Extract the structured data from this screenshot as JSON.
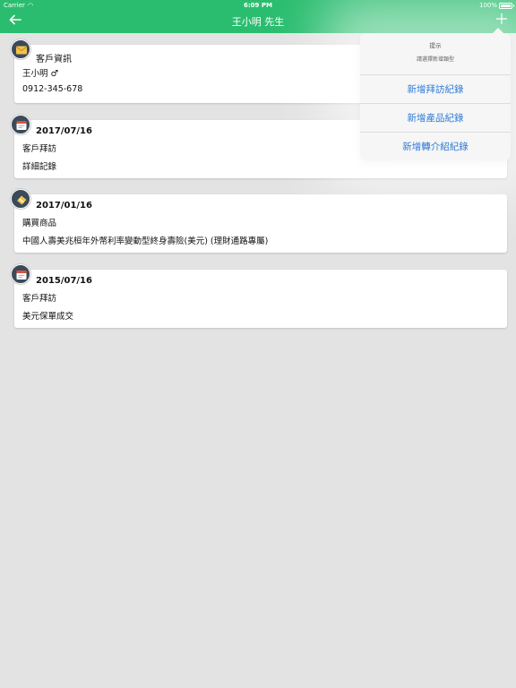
{
  "status_bar": {
    "carrier": "Carrier",
    "time": "6:09 PM",
    "battery": "100%",
    "battery_level": 1.0
  },
  "nav": {
    "title": "王小明 先生",
    "back_icon": "arrow-left-icon",
    "add_icon": "plus-icon"
  },
  "colors": {
    "nav_bg": "#2bbd6f",
    "action_text": "#2e7ad6",
    "background": "#e3e3e3"
  },
  "cards": [
    {
      "icon": "envelope-icon",
      "title": "客戶資訊",
      "lines": [
        "王小明 ♂",
        "0912-345-678"
      ]
    },
    {
      "icon": "calendar-icon",
      "title": "2017/07/16",
      "lines": [
        "客戶拜訪",
        "詳細記錄"
      ]
    },
    {
      "icon": "product-box-icon",
      "title": "2017/01/16",
      "lines": [
        "購買商品",
        "中國人壽美兆桓年外幣利率變動型終身壽險(美元) (理財通路專屬)"
      ]
    },
    {
      "icon": "calendar-icon",
      "title": "2015/07/16",
      "lines": [
        "客戶拜訪",
        "美元保單成交"
      ]
    }
  ],
  "popover": {
    "title": "提示",
    "message": "請選擇新增類型",
    "options": [
      "新增拜訪紀錄",
      "新增產品紀錄",
      "新增轉介紹紀錄"
    ]
  }
}
